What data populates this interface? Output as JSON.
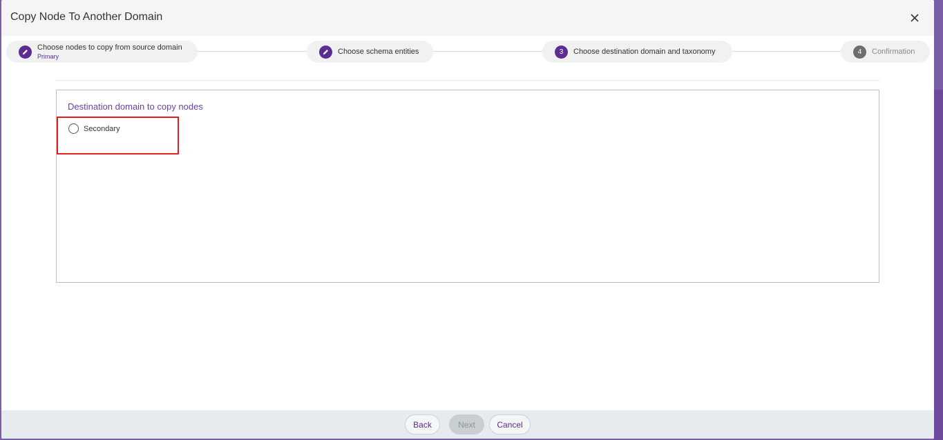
{
  "dialog": {
    "title": "Copy Node To Another Domain",
    "close_icon": "close-icon"
  },
  "stepper": {
    "steps": [
      {
        "label": "Choose nodes to copy from source domain",
        "sublabel": "Primary",
        "state": "completed",
        "icon": "pencil-icon"
      },
      {
        "label": "Choose schema entities",
        "state": "completed",
        "icon": "pencil-icon"
      },
      {
        "label": "Choose destination domain and taxonomy",
        "number": "3",
        "state": "active"
      },
      {
        "label": "Confirmation",
        "number": "4",
        "state": "pending"
      }
    ]
  },
  "panel": {
    "title": "Destination domain to copy nodes",
    "options": [
      {
        "label": "Secondary",
        "selected": false
      }
    ]
  },
  "footer": {
    "back_label": "Back",
    "next_label": "Next",
    "next_disabled": true,
    "cancel_label": "Cancel"
  },
  "colors": {
    "accent": "#5c2d91",
    "panel_title": "#6b45a6",
    "highlight": "#e02020"
  }
}
